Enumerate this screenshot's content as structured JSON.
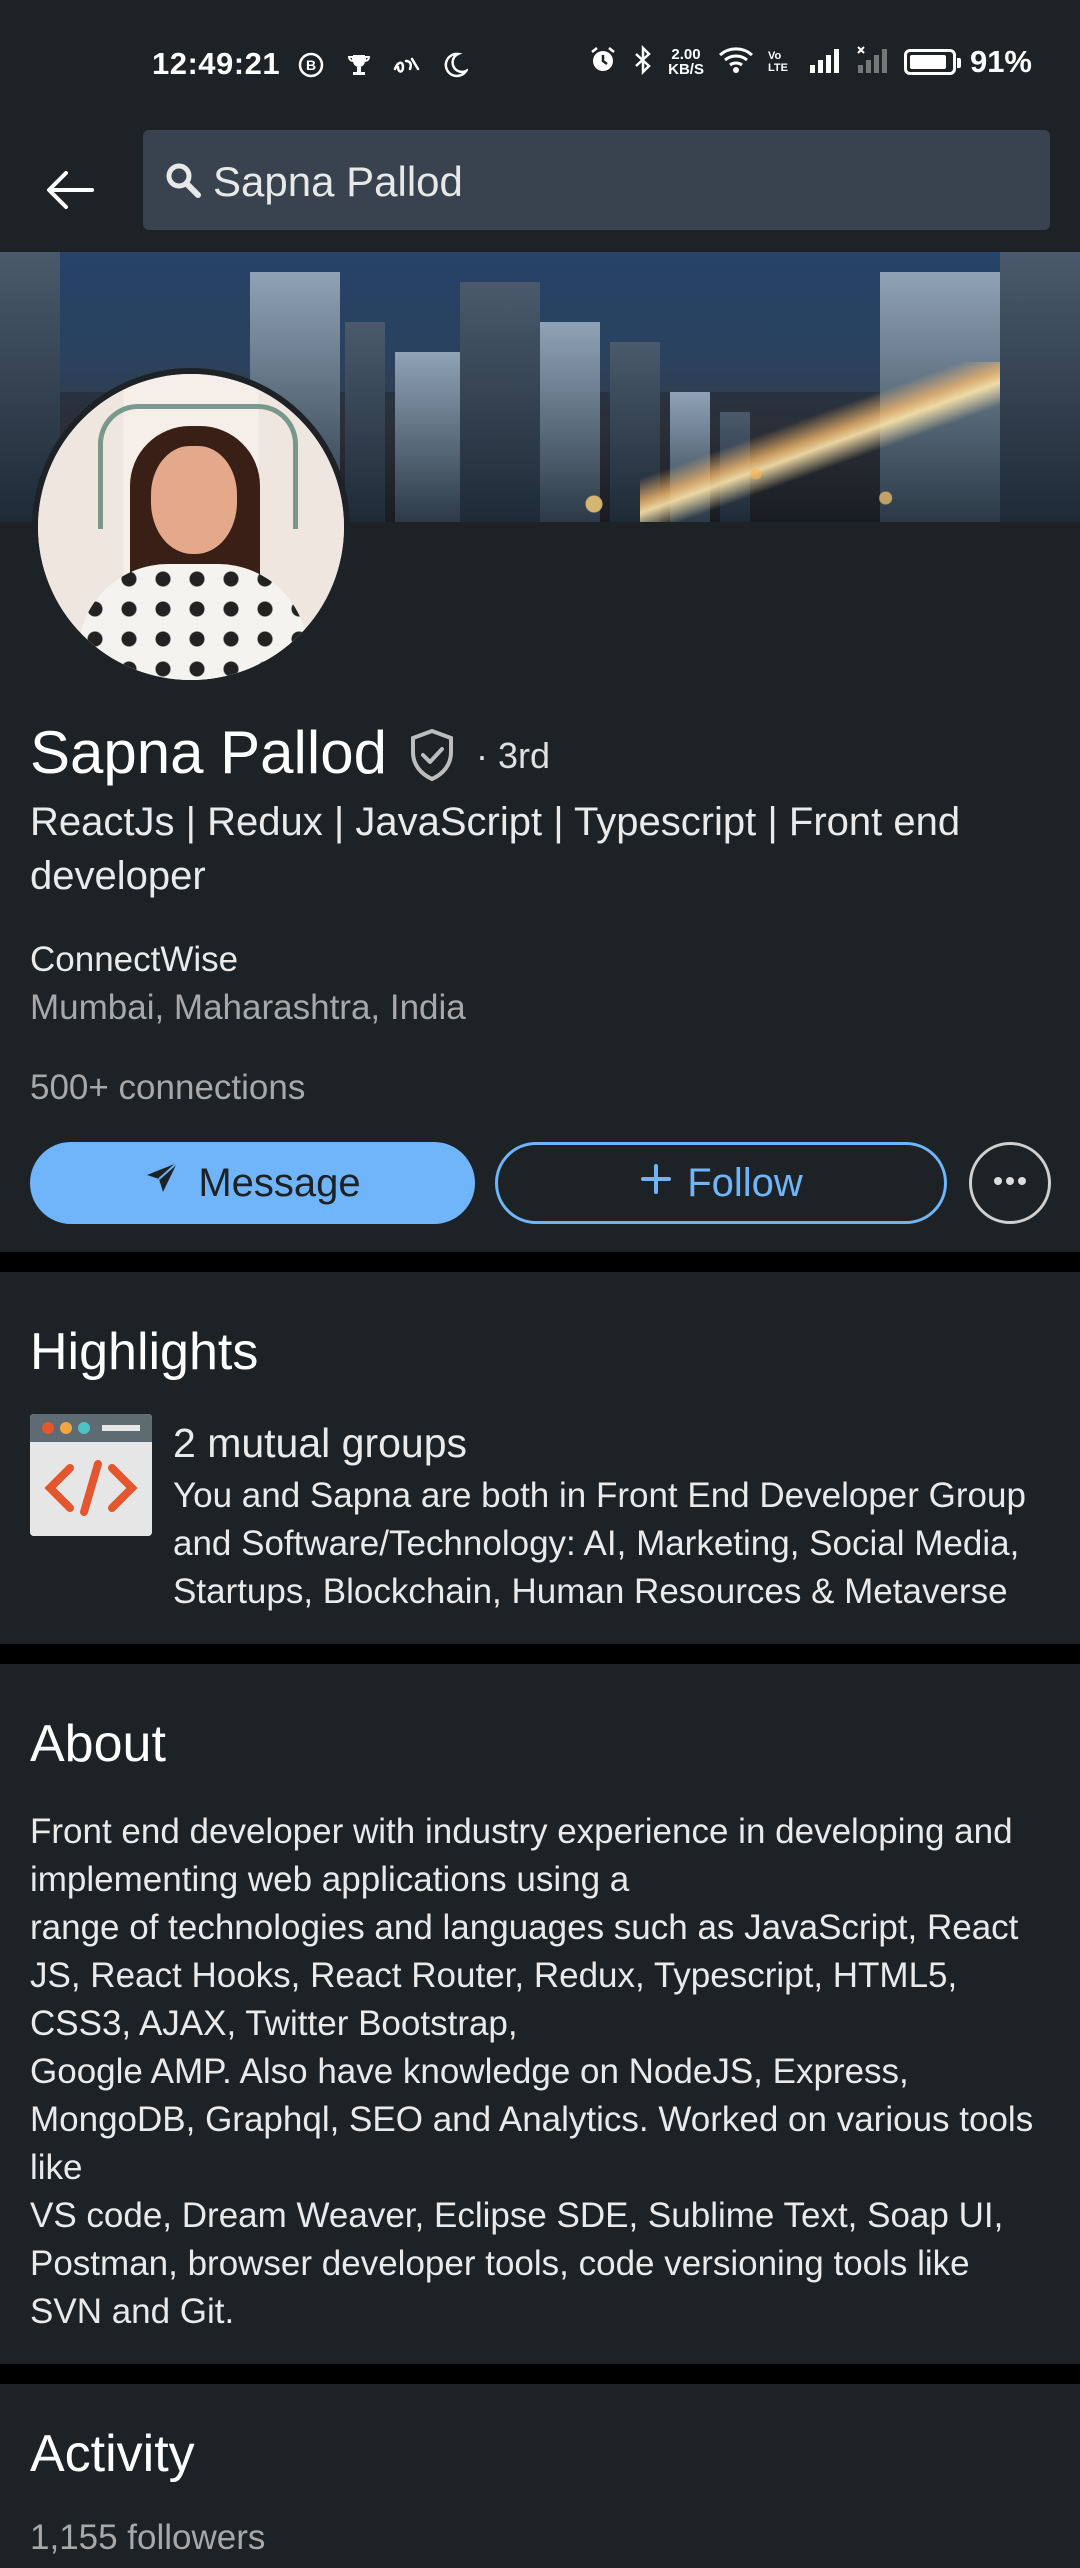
{
  "status_bar": {
    "time": "12:49:21",
    "left_icons": [
      "b-circle-icon",
      "trophy-icon",
      "script-icon",
      "moon-icon"
    ],
    "network_speed_value": "2.00",
    "network_speed_unit": "KB/S",
    "volte_label": "Vo LTE",
    "battery_percent": "91%",
    "battery_level": 0.91
  },
  "search": {
    "query": "Sapna Pallod"
  },
  "profile": {
    "name": "Sapna Pallod",
    "degree": "· 3rd",
    "headline": "ReactJs | Redux | JavaScript | Typescript | Front end developer",
    "company": "ConnectWise",
    "location": "Mumbai, Maharashtra, India",
    "connections": "500+ connections"
  },
  "actions": {
    "message_label": "Message",
    "follow_label": "Follow"
  },
  "highlights": {
    "title": "Highlights",
    "item_title": "2 mutual groups",
    "item_description": "You and Sapna are both in Front End Developer Group and Software/Technology: AI, Marketing, Social Media, Startups, Blockchain, Human Resources & Metaverse"
  },
  "about": {
    "title": "About",
    "text": "Front end developer with industry experience in developing and implementing web applications using a\nrange of technologies and languages such as JavaScript, React JS, React Hooks, React Router, Redux, Typescript, HTML5, CSS3, AJAX, Twitter Bootstrap,\nGoogle AMP. Also have knowledge on NodeJS, Express, MongoDB, Graphql, SEO and Analytics. Worked on various tools like\nVS code, Dream Weaver, Eclipse SDE, Sublime Text, Soap UI, Postman, browser developer tools, code versioning tools like\nSVN and Git."
  },
  "activity": {
    "title": "Activity",
    "followers": "1,155 followers"
  },
  "colors": {
    "background": "#1d2226",
    "accent": "#70b5f9",
    "separator": "#000000",
    "muted_text": "#a8a8a8"
  }
}
